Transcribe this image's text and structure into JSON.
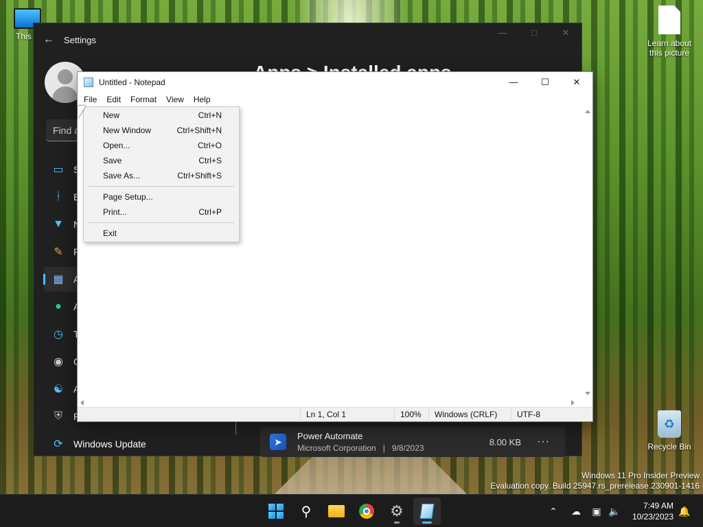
{
  "desktop": {
    "icons": [
      {
        "label": "This P"
      },
      {
        "label": "Learn about this picture"
      },
      {
        "label": "Recycle Bin"
      }
    ],
    "watermark": {
      "line1": "Windows 11 Pro Insider Preview",
      "line2": "Evaluation copy. Build 25947.rs_prerelease.230901-1416"
    }
  },
  "settings": {
    "title": "Settings",
    "heading": "Apps  >  Installed apps",
    "search_placeholder": "Find a",
    "nav": [
      {
        "icon": "system-icon",
        "label": "S"
      },
      {
        "icon": "bluetooth-icon",
        "label": "B"
      },
      {
        "icon": "wifi-icon",
        "label": "N"
      },
      {
        "icon": "brush-icon",
        "label": "P"
      },
      {
        "icon": "apps-icon",
        "label": "A",
        "active": true
      },
      {
        "icon": "accounts-icon",
        "label": "A"
      },
      {
        "icon": "time-icon",
        "label": "T"
      },
      {
        "icon": "gaming-icon",
        "label": "G"
      },
      {
        "icon": "accessibility-icon",
        "label": "A"
      },
      {
        "icon": "shield-icon",
        "label": "P"
      },
      {
        "icon": "update-icon",
        "label": "Windows Update"
      }
    ],
    "app_row": {
      "name": "Power Automate",
      "publisher": "Microsoft Corporation",
      "date": "9/8/2023",
      "size": "8.00 KB",
      "more": "···"
    }
  },
  "notepad": {
    "title": "Untitled - Notepad",
    "menus": [
      "File",
      "Edit",
      "Format",
      "View",
      "Help"
    ],
    "file_menu": [
      {
        "label": "New",
        "shortcut": "Ctrl+N"
      },
      {
        "label": "New Window",
        "shortcut": "Ctrl+Shift+N"
      },
      {
        "label": "Open...",
        "shortcut": "Ctrl+O"
      },
      {
        "label": "Save",
        "shortcut": "Ctrl+S"
      },
      {
        "label": "Save As...",
        "shortcut": "Ctrl+Shift+S"
      },
      {
        "label": "Page Setup...",
        "shortcut": ""
      },
      {
        "label": "Print...",
        "shortcut": "Ctrl+P"
      },
      {
        "label": "Exit",
        "shortcut": ""
      }
    ],
    "status": {
      "position": "Ln 1, Col 1",
      "zoom": "100%",
      "line_ending": "Windows (CRLF)",
      "encoding": "UTF-8"
    }
  },
  "taskbar": {
    "apps": [
      "start-icon",
      "search-icon",
      "file-explorer-icon",
      "chrome-icon",
      "settings-icon",
      "notepad-icon"
    ],
    "clock": {
      "time": "7:49 AM",
      "date": "10/23/2023"
    }
  },
  "colors": {
    "accent": "#4cc2ff",
    "settings_bg": "#202020",
    "taskbar_bg": "#1c1c1c",
    "menu_bg": "#f2f2f2"
  }
}
